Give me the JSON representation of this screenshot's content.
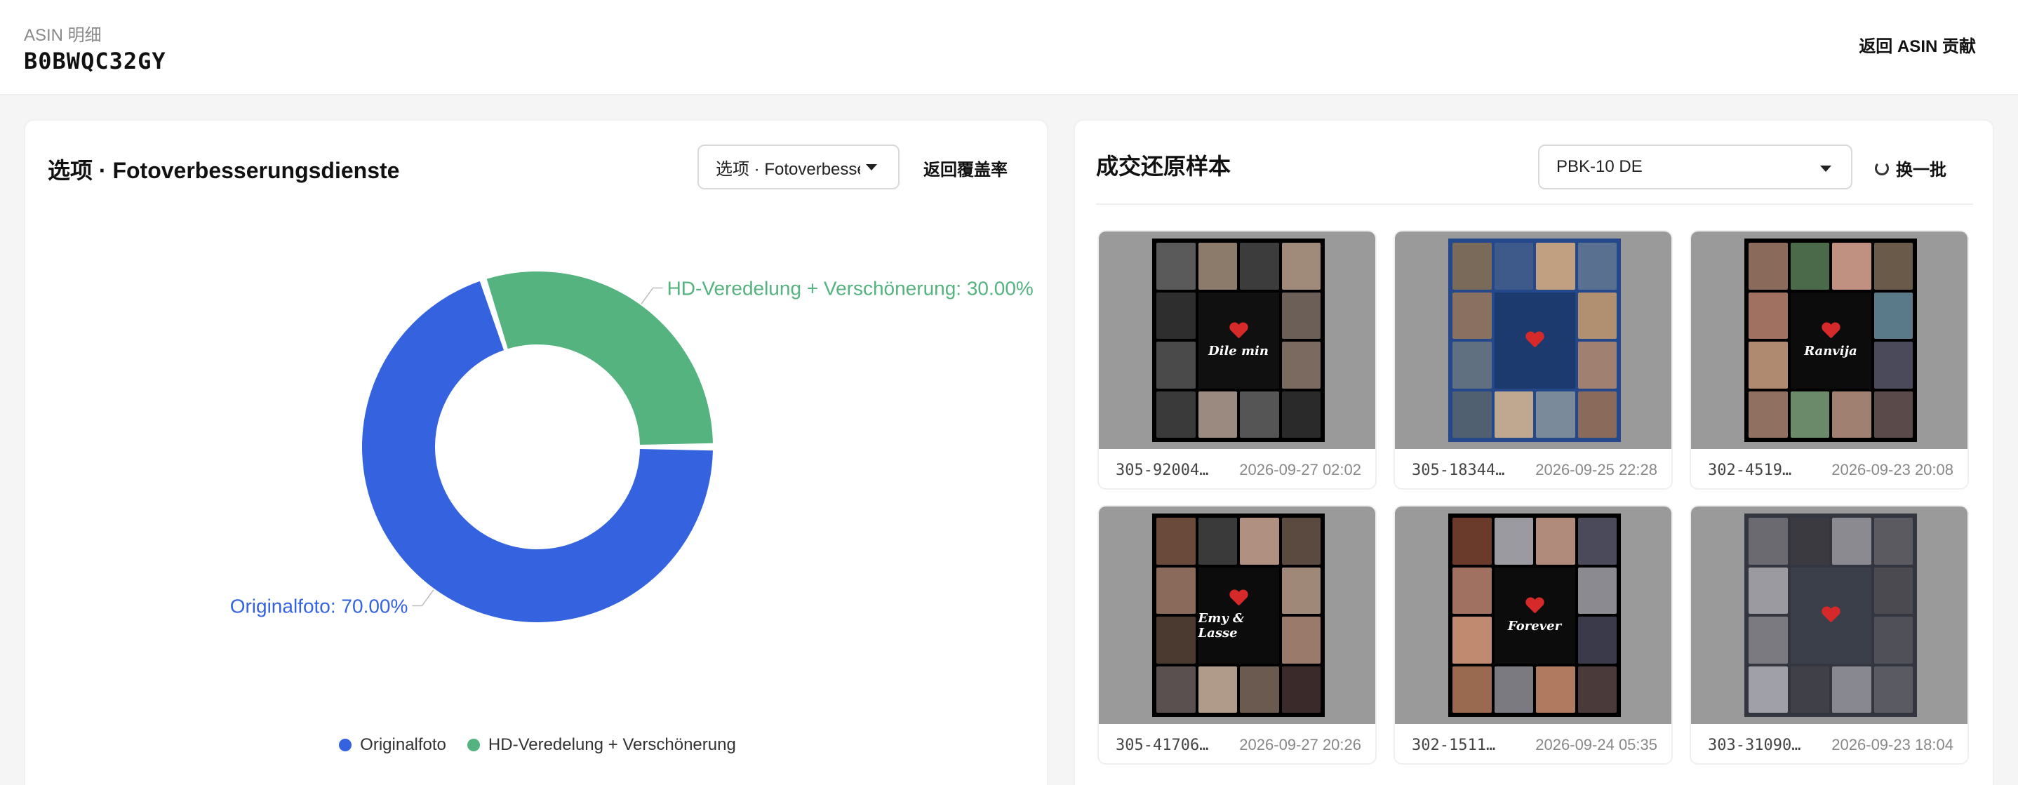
{
  "header": {
    "crumb": "ASIN 明细",
    "asin": "B0BWQC32GY",
    "back_label": "返回 ASIN 贡献"
  },
  "left_panel": {
    "title": "选项 · Fotoverbesserungsdienste",
    "select_value": "选项 · Fotoverbesserungsdienste",
    "back_label": "返回覆盖率"
  },
  "chart_data": {
    "type": "pie",
    "donut": true,
    "title": "",
    "categories": [
      "Originalfoto",
      "HD-Veredelung + Verschönerung"
    ],
    "values": [
      70.0,
      30.0
    ],
    "colors": [
      "#3563e0",
      "#55b37f"
    ],
    "data_labels": [
      "Originalfoto: 70.00%",
      "HD-Veredelung + Verschönerung: 30.00%"
    ],
    "legend": [
      "Originalfoto",
      "HD-Veredelung + Verschönerung"
    ],
    "legend_position": "bottom"
  },
  "right_panel": {
    "title": "成交还原样本",
    "select_value": "PBK-10 DE",
    "refresh_label": "换一批",
    "samples": [
      {
        "order": "305-92004…",
        "time": "2026-09-27 02:02",
        "name": "Dile min",
        "bg": "#101010",
        "frame": "#000000"
      },
      {
        "order": "305-18344…",
        "time": "2026-09-25 22:28",
        "name": "",
        "bg": "#1d3a6e",
        "frame": "#24488a"
      },
      {
        "order": "302-4519…",
        "time": "2026-09-23 20:08",
        "name": "Ranvija",
        "bg": "#0c0c0c",
        "frame": "#000000"
      },
      {
        "order": "305-41706…",
        "time": "2026-09-27 20:26",
        "name": "Emy & Lasse",
        "bg": "#0c0c0c",
        "frame": "#000000"
      },
      {
        "order": "302-1511…",
        "time": "2026-09-24 05:35",
        "name": "Forever",
        "bg": "#0c0c0c",
        "frame": "#000000"
      },
      {
        "order": "303-31090…",
        "time": "2026-09-23 18:04",
        "name": "",
        "bg": "#3b3f4a",
        "frame": "#33363f"
      }
    ]
  }
}
